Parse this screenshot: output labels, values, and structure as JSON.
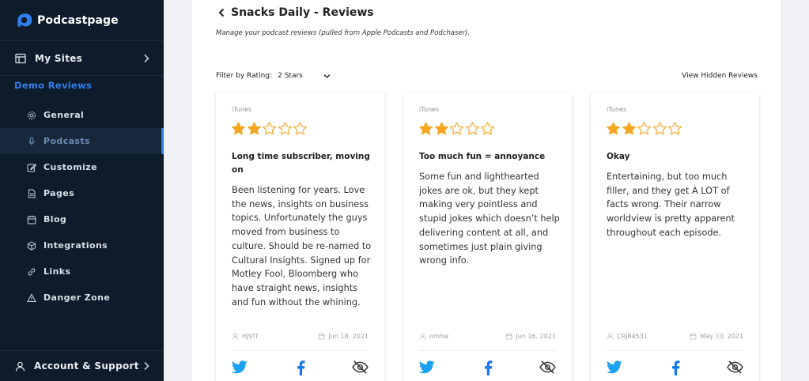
{
  "sidebar": {
    "brand": "Podcastpage",
    "my_sites": "My Sites",
    "section_title": "Demo Reviews",
    "items": [
      {
        "label": "General",
        "icon": "gear-icon",
        "active": false
      },
      {
        "label": "Podcasts",
        "icon": "microphone-icon",
        "active": true
      },
      {
        "label": "Customize",
        "icon": "edit-icon",
        "active": false
      },
      {
        "label": "Pages",
        "icon": "page-icon",
        "active": false
      },
      {
        "label": "Blog",
        "icon": "calendar-icon",
        "active": false
      },
      {
        "label": "Integrations",
        "icon": "cube-icon",
        "active": false
      },
      {
        "label": "Links",
        "icon": "link-icon",
        "active": false
      },
      {
        "label": "Danger Zone",
        "icon": "warning-icon",
        "active": false
      }
    ],
    "account": "Account & Support"
  },
  "header": {
    "title": "Snacks Daily - Reviews",
    "description": "Manage your podcast reviews (pulled from Apple Podcasts and Podchaser)."
  },
  "filter": {
    "label": "Filter by Rating:",
    "value": "2 Stars",
    "hidden_link": "View Hidden Reviews"
  },
  "reviews": [
    {
      "source": "iTunes",
      "rating": 2,
      "max_rating": 5,
      "title": "Long time subscriber, moving on",
      "body": "Been listening for years. Love the news, insights on business topics. Unfortunately the guys moved from business to culture. Should be re-named to Cultural Insights. Signed up for Motley Fool, Bloomberg who have straight news, insights and fun without the whining.",
      "author": "HJVIT",
      "date": "Jun 18, 2021"
    },
    {
      "source": "iTunes",
      "rating": 2,
      "max_rating": 5,
      "title": "Too much fun = annoyance",
      "body": "Some fun and lighthearted jokes are ok, but they kept making very pointless and stupid jokes which doesn’t help delivering content at all, and sometimes just plain giving wrong info.",
      "author": "nmhw",
      "date": "Jun 16, 2021"
    },
    {
      "source": "iTunes",
      "rating": 2,
      "max_rating": 5,
      "title": "Okay",
      "body": "Entertaining, but too much filler, and they get A LOT of facts wrong. Their narrow worldview is pretty apparent throughout each episode.",
      "author": "CRJ84531",
      "date": "May 10, 2021"
    }
  ],
  "colors": {
    "sidebar_bg": "#0d1b2a",
    "accent": "#2f80ed",
    "star": "#f5a623",
    "twitter": "#1da1f2",
    "facebook": "#1877f2"
  }
}
